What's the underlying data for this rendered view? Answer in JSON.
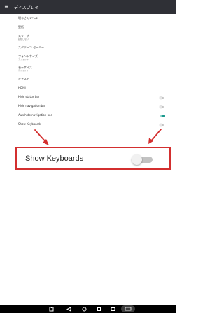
{
  "app_bar": {
    "menu_icon": "menu-icon",
    "title": "ディスプレイ"
  },
  "settings": [
    {
      "id": "brightness",
      "title": "明るさのレベル",
      "subtitle": ""
    },
    {
      "id": "wallpaper",
      "title": "壁紙",
      "subtitle": ""
    },
    {
      "id": "sleep",
      "title": "スリープ",
      "subtitle": "起動しない"
    },
    {
      "id": "screensaver",
      "title": "スクリーン セーバー",
      "subtitle": ""
    },
    {
      "id": "font-size",
      "title": "フォントサイズ",
      "subtitle": "デフォルト"
    },
    {
      "id": "display-size",
      "title": "表示サイズ",
      "subtitle": "デフォルト"
    },
    {
      "id": "cast",
      "title": "キャスト",
      "subtitle": ""
    },
    {
      "id": "hdmi",
      "title": "HDMI",
      "subtitle": ""
    },
    {
      "id": "hide-status-bar",
      "title": "Hide status bar",
      "subtitle": "",
      "toggle": "off"
    },
    {
      "id": "hide-navigation-bar",
      "title": "Hide navigation bar",
      "subtitle": "",
      "toggle": "off"
    },
    {
      "id": "autohide-navigation-bar",
      "title": "Autohide navigation bar",
      "subtitle": "",
      "toggle": "on"
    },
    {
      "id": "show-keyboards",
      "title": "Show Keyboards",
      "subtitle": "",
      "toggle": "off"
    }
  ],
  "callout": {
    "label": "Show Keyboards",
    "toggle_state": "off",
    "border_color": "#d32f2f",
    "arrow_color": "#d32f2f"
  },
  "colors": {
    "app_bar": "#2f3036",
    "toggle_on": "#17978b",
    "toggle_off": "#c2c2c2",
    "nav_bar": "#000000"
  },
  "nav_bar": {
    "buttons": [
      "screenshot-icon",
      "back-icon",
      "home-icon",
      "recents-icon",
      "volume-icon",
      "keyboard-icon"
    ]
  }
}
